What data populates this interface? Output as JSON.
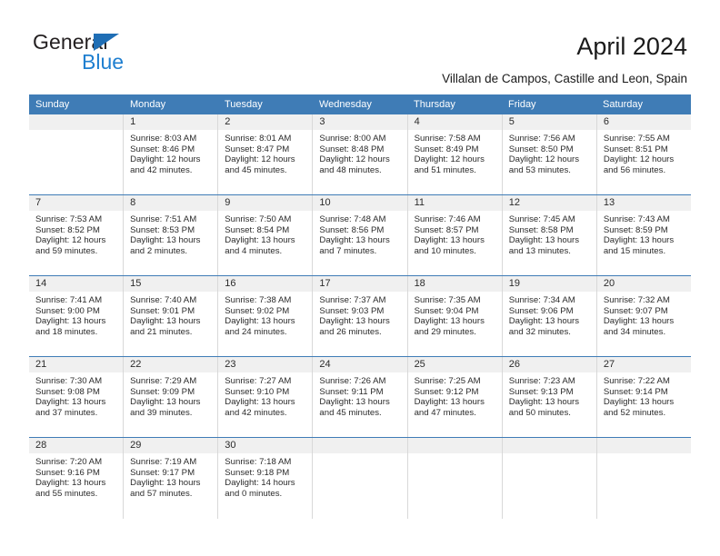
{
  "brand": {
    "name_part1": "General",
    "name_part2": "Blue",
    "logo_icon": "blue-triangle-icon",
    "accent_color": "#1f7fd0"
  },
  "header": {
    "title": "April 2024",
    "subtitle": "Villalan de Campos, Castille and Leon, Spain"
  },
  "calendar": {
    "header_bg": "#3f7cb6",
    "daynum_bg": "#f0f0f0",
    "weekdays": [
      "Sunday",
      "Monday",
      "Tuesday",
      "Wednesday",
      "Thursday",
      "Friday",
      "Saturday"
    ],
    "weeks": [
      [
        {
          "day": "",
          "sunrise": "",
          "sunset": "",
          "daylight": "",
          "empty": true
        },
        {
          "day": "1",
          "sunrise": "Sunrise: 8:03 AM",
          "sunset": "Sunset: 8:46 PM",
          "daylight": "Daylight: 12 hours and 42 minutes."
        },
        {
          "day": "2",
          "sunrise": "Sunrise: 8:01 AM",
          "sunset": "Sunset: 8:47 PM",
          "daylight": "Daylight: 12 hours and 45 minutes."
        },
        {
          "day": "3",
          "sunrise": "Sunrise: 8:00 AM",
          "sunset": "Sunset: 8:48 PM",
          "daylight": "Daylight: 12 hours and 48 minutes."
        },
        {
          "day": "4",
          "sunrise": "Sunrise: 7:58 AM",
          "sunset": "Sunset: 8:49 PM",
          "daylight": "Daylight: 12 hours and 51 minutes."
        },
        {
          "day": "5",
          "sunrise": "Sunrise: 7:56 AM",
          "sunset": "Sunset: 8:50 PM",
          "daylight": "Daylight: 12 hours and 53 minutes."
        },
        {
          "day": "6",
          "sunrise": "Sunrise: 7:55 AM",
          "sunset": "Sunset: 8:51 PM",
          "daylight": "Daylight: 12 hours and 56 minutes."
        }
      ],
      [
        {
          "day": "7",
          "sunrise": "Sunrise: 7:53 AM",
          "sunset": "Sunset: 8:52 PM",
          "daylight": "Daylight: 12 hours and 59 minutes."
        },
        {
          "day": "8",
          "sunrise": "Sunrise: 7:51 AM",
          "sunset": "Sunset: 8:53 PM",
          "daylight": "Daylight: 13 hours and 2 minutes."
        },
        {
          "day": "9",
          "sunrise": "Sunrise: 7:50 AM",
          "sunset": "Sunset: 8:54 PM",
          "daylight": "Daylight: 13 hours and 4 minutes."
        },
        {
          "day": "10",
          "sunrise": "Sunrise: 7:48 AM",
          "sunset": "Sunset: 8:56 PM",
          "daylight": "Daylight: 13 hours and 7 minutes."
        },
        {
          "day": "11",
          "sunrise": "Sunrise: 7:46 AM",
          "sunset": "Sunset: 8:57 PM",
          "daylight": "Daylight: 13 hours and 10 minutes."
        },
        {
          "day": "12",
          "sunrise": "Sunrise: 7:45 AM",
          "sunset": "Sunset: 8:58 PM",
          "daylight": "Daylight: 13 hours and 13 minutes."
        },
        {
          "day": "13",
          "sunrise": "Sunrise: 7:43 AM",
          "sunset": "Sunset: 8:59 PM",
          "daylight": "Daylight: 13 hours and 15 minutes."
        }
      ],
      [
        {
          "day": "14",
          "sunrise": "Sunrise: 7:41 AM",
          "sunset": "Sunset: 9:00 PM",
          "daylight": "Daylight: 13 hours and 18 minutes."
        },
        {
          "day": "15",
          "sunrise": "Sunrise: 7:40 AM",
          "sunset": "Sunset: 9:01 PM",
          "daylight": "Daylight: 13 hours and 21 minutes."
        },
        {
          "day": "16",
          "sunrise": "Sunrise: 7:38 AM",
          "sunset": "Sunset: 9:02 PM",
          "daylight": "Daylight: 13 hours and 24 minutes."
        },
        {
          "day": "17",
          "sunrise": "Sunrise: 7:37 AM",
          "sunset": "Sunset: 9:03 PM",
          "daylight": "Daylight: 13 hours and 26 minutes."
        },
        {
          "day": "18",
          "sunrise": "Sunrise: 7:35 AM",
          "sunset": "Sunset: 9:04 PM",
          "daylight": "Daylight: 13 hours and 29 minutes."
        },
        {
          "day": "19",
          "sunrise": "Sunrise: 7:34 AM",
          "sunset": "Sunset: 9:06 PM",
          "daylight": "Daylight: 13 hours and 32 minutes."
        },
        {
          "day": "20",
          "sunrise": "Sunrise: 7:32 AM",
          "sunset": "Sunset: 9:07 PM",
          "daylight": "Daylight: 13 hours and 34 minutes."
        }
      ],
      [
        {
          "day": "21",
          "sunrise": "Sunrise: 7:30 AM",
          "sunset": "Sunset: 9:08 PM",
          "daylight": "Daylight: 13 hours and 37 minutes."
        },
        {
          "day": "22",
          "sunrise": "Sunrise: 7:29 AM",
          "sunset": "Sunset: 9:09 PM",
          "daylight": "Daylight: 13 hours and 39 minutes."
        },
        {
          "day": "23",
          "sunrise": "Sunrise: 7:27 AM",
          "sunset": "Sunset: 9:10 PM",
          "daylight": "Daylight: 13 hours and 42 minutes."
        },
        {
          "day": "24",
          "sunrise": "Sunrise: 7:26 AM",
          "sunset": "Sunset: 9:11 PM",
          "daylight": "Daylight: 13 hours and 45 minutes."
        },
        {
          "day": "25",
          "sunrise": "Sunrise: 7:25 AM",
          "sunset": "Sunset: 9:12 PM",
          "daylight": "Daylight: 13 hours and 47 minutes."
        },
        {
          "day": "26",
          "sunrise": "Sunrise: 7:23 AM",
          "sunset": "Sunset: 9:13 PM",
          "daylight": "Daylight: 13 hours and 50 minutes."
        },
        {
          "day": "27",
          "sunrise": "Sunrise: 7:22 AM",
          "sunset": "Sunset: 9:14 PM",
          "daylight": "Daylight: 13 hours and 52 minutes."
        }
      ],
      [
        {
          "day": "28",
          "sunrise": "Sunrise: 7:20 AM",
          "sunset": "Sunset: 9:16 PM",
          "daylight": "Daylight: 13 hours and 55 minutes."
        },
        {
          "day": "29",
          "sunrise": "Sunrise: 7:19 AM",
          "sunset": "Sunset: 9:17 PM",
          "daylight": "Daylight: 13 hours and 57 minutes."
        },
        {
          "day": "30",
          "sunrise": "Sunrise: 7:18 AM",
          "sunset": "Sunset: 9:18 PM",
          "daylight": "Daylight: 14 hours and 0 minutes."
        },
        {
          "day": "",
          "sunrise": "",
          "sunset": "",
          "daylight": "",
          "empty": true
        },
        {
          "day": "",
          "sunrise": "",
          "sunset": "",
          "daylight": "",
          "empty": true
        },
        {
          "day": "",
          "sunrise": "",
          "sunset": "",
          "daylight": "",
          "empty": true
        },
        {
          "day": "",
          "sunrise": "",
          "sunset": "",
          "daylight": "",
          "empty": true
        }
      ]
    ]
  }
}
